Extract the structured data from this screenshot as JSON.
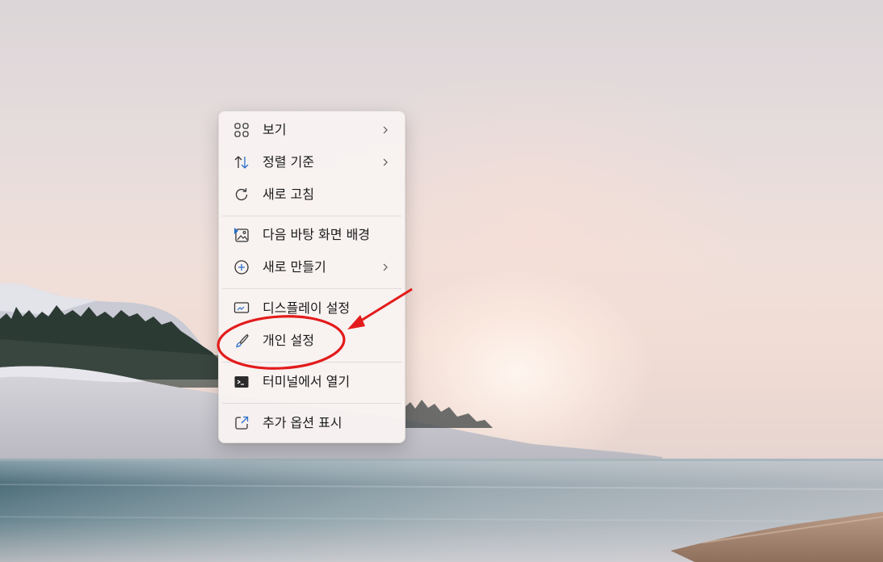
{
  "context_menu": {
    "items": [
      {
        "label": "보기",
        "icon": "grid-view-icon",
        "has_submenu": true
      },
      {
        "label": "정렬 기준",
        "icon": "sort-arrows-icon",
        "has_submenu": true
      },
      {
        "label": "새로 고침",
        "icon": "refresh-icon",
        "has_submenu": false
      },
      {
        "label": "다음 바탕 화면 배경",
        "icon": "next-background-icon",
        "has_submenu": false
      },
      {
        "label": "새로 만들기",
        "icon": "add-circle-icon",
        "has_submenu": true
      },
      {
        "label": "디스플레이 설정",
        "icon": "display-icon",
        "has_submenu": false
      },
      {
        "label": "개인 설정",
        "icon": "paintbrush-icon",
        "has_submenu": false
      },
      {
        "label": "터미널에서 열기",
        "icon": "terminal-icon",
        "has_submenu": false
      },
      {
        "label": "추가 옵션 표시",
        "icon": "more-options-icon",
        "has_submenu": false
      }
    ]
  },
  "annotation": {
    "highlighted_item": "개인 설정",
    "color": "#e31b1b"
  },
  "colors": {
    "icon_accent": "#2a6fc9",
    "text": "#1b1b1b"
  }
}
